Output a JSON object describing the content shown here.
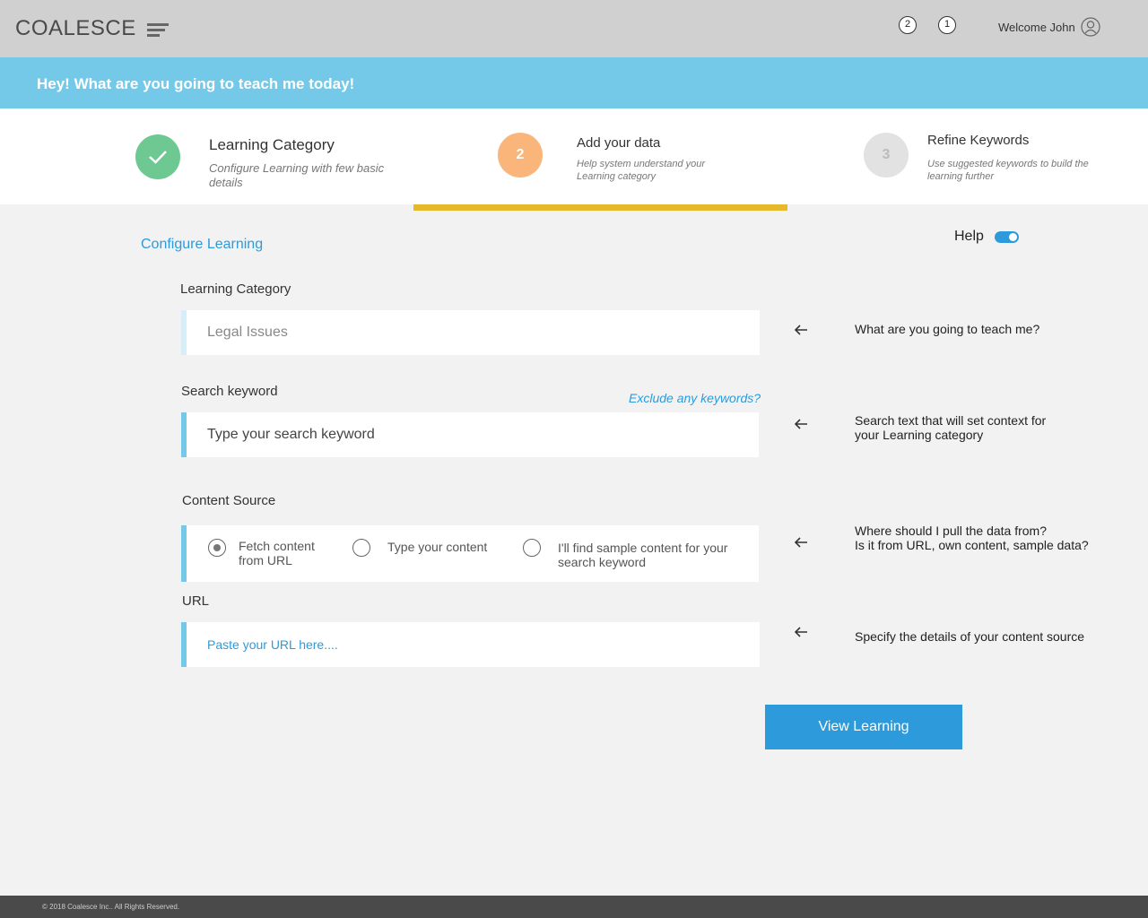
{
  "header": {
    "logo": "COALESCE",
    "notifications": [
      "2",
      "1"
    ],
    "welcome": "Welcome John"
  },
  "banner": {
    "text": "Hey! What are you going to teach me today!"
  },
  "steps": [
    {
      "title": "Learning Category",
      "description": "Configure Learning with few basic details",
      "state": "done",
      "icon": "check-icon"
    },
    {
      "title": "Add your data",
      "description": "Help system understand your Learning category",
      "number": "2",
      "state": "active"
    },
    {
      "title": "Refine Keywords",
      "description": "Use suggested keywords to build the learning further",
      "number": "3",
      "state": "pending"
    }
  ],
  "form": {
    "section_title": "Configure Learning",
    "help_label": "Help",
    "help_enabled": true,
    "category": {
      "label": "Learning Category",
      "placeholder": "Legal Issues"
    },
    "keyword": {
      "label": "Search keyword",
      "placeholder": "Type your search keyword",
      "exclude_link": "Exclude any keywords?"
    },
    "content_source": {
      "label": "Content Source",
      "options": [
        "Fetch content from URL",
        "Type your content",
        "I'll find sample content for your search keyword"
      ],
      "selected": 0
    },
    "url": {
      "label": "URL",
      "placeholder": "Paste your URL here...."
    },
    "submit_label": "View Learning"
  },
  "hints": {
    "category": "What are you going to teach me?",
    "keyword": "Search text that will set context for your Learning category",
    "source_line1": "Where should I pull the data from?",
    "source_line2": "Is it from URL, own content, sample data?",
    "url": "Specify the details of your content source"
  },
  "colors": {
    "accent": "#2d9bdb",
    "banner": "#74c9e8",
    "step_done": "#6dc892",
    "step_active": "#f9b57a",
    "progress": "#e6b82a"
  },
  "footer": {
    "copyright": "© 2018 Coalesce Inc.. All Rights Reserved."
  }
}
